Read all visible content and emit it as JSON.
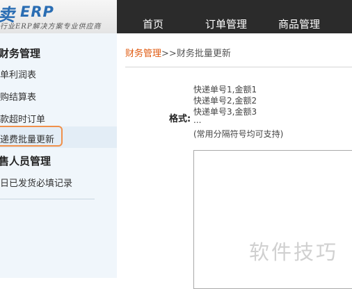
{
  "header": {
    "logo_cn": "卖",
    "logo_en": "ERP",
    "logo_tagline": "行业ERP解决方案专业供应商",
    "nav": [
      {
        "label": "首页"
      },
      {
        "label": "订单管理"
      },
      {
        "label": "商品管理"
      }
    ]
  },
  "sidebar": {
    "section1_title": "财务管理",
    "items": [
      {
        "label": "单利润表"
      },
      {
        "label": "购结算表"
      },
      {
        "label": "款超时订单"
      },
      {
        "label": "递费批量更新",
        "active": true
      }
    ],
    "section2_title": "售人员管理",
    "items2": [
      {
        "label": "日已发货必填记录"
      }
    ]
  },
  "breadcrumb": {
    "parent": "财务管理",
    "separator": ">>",
    "current": "财务批量更新"
  },
  "form": {
    "format_label": "格式:",
    "format_lines": [
      "快递单号1,金额1",
      "快递单号2,金额2",
      "快递单号3,金额3",
      "...",
      "(常用分隔符号均可支持)"
    ],
    "textarea_value": ""
  },
  "watermark": "软件技巧",
  "colors": {
    "topbar_bg": "#2b2b2b",
    "sidebar_bg": "#f0f6fb",
    "breadcrumb_link": "#e05a10",
    "active_outline": "#f0904a",
    "logo_blue": "#2a6db3"
  }
}
